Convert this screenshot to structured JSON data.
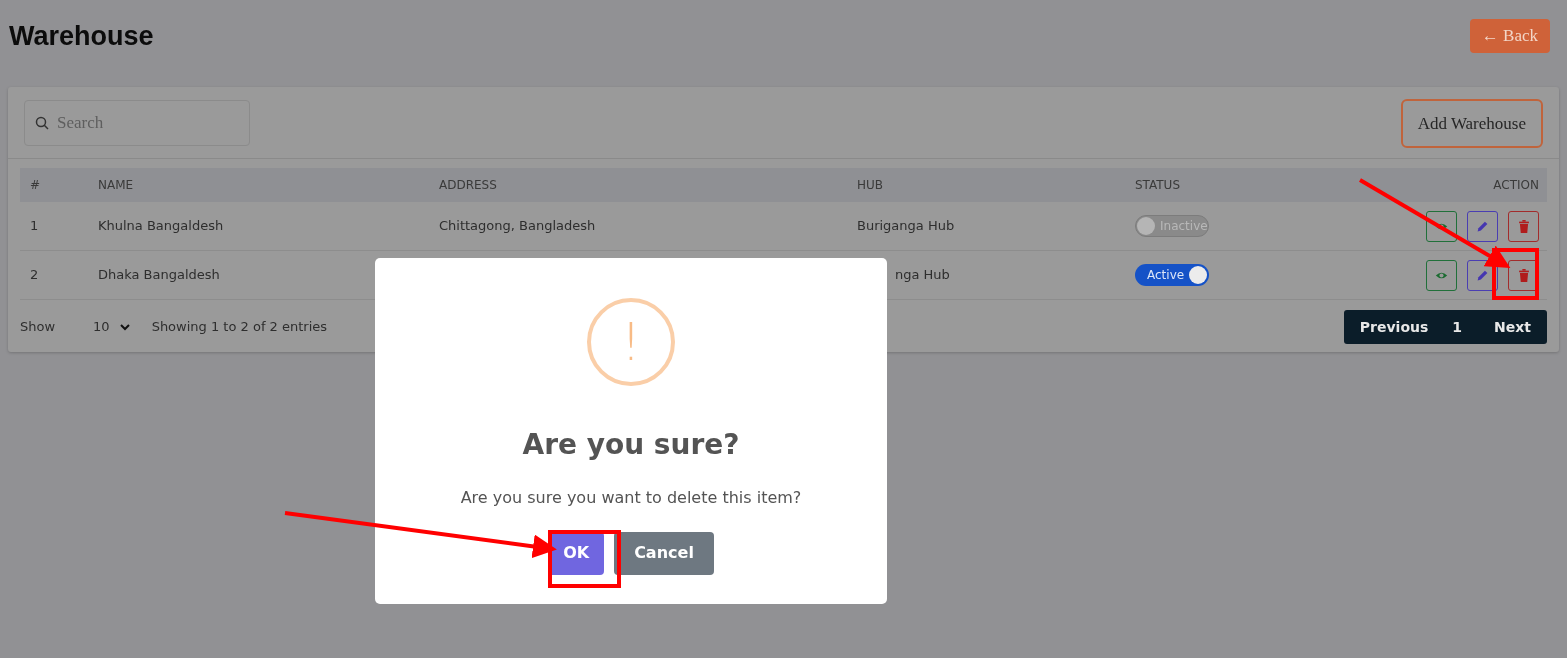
{
  "page": {
    "title": "Warehouse",
    "back_button": {
      "arrow": "←",
      "label": "Back"
    }
  },
  "toolbar": {
    "search": {
      "placeholder": "Search"
    },
    "add_button": "Add Warehouse"
  },
  "table": {
    "columns": [
      "#",
      "NAME",
      "ADDRESS",
      "HUB",
      "STATUS",
      "ACTION"
    ],
    "rows": [
      {
        "index": "1",
        "name": "Khulna Bangaldesh",
        "address": "Chittagong, Bangladesh",
        "hub": "Buriganga Hub",
        "hub_cut_left": false,
        "status": {
          "on": false,
          "label": "Inactive"
        }
      },
      {
        "index": "2",
        "name": "Dhaka Bangaldesh",
        "hub": "nga Hub",
        "hub_cut_left": true,
        "status": {
          "on": true,
          "label": "Active"
        }
      }
    ]
  },
  "footer": {
    "show_label": "Show",
    "page_size": "10",
    "entries": "Showing 1 to 2 of 2 entries",
    "pagination": [
      {
        "label": "Previous",
        "kind": "prev"
      },
      {
        "label": "1",
        "kind": "page"
      },
      {
        "label": "Next",
        "kind": "next"
      }
    ]
  },
  "dialog": {
    "icon": "!",
    "title": "Are you sure?",
    "message": "Are you sure you want to delete this item?",
    "buttons": [
      {
        "label": "OK",
        "kind": "confirm"
      },
      {
        "label": "Cancel",
        "kind": "cancel"
      }
    ]
  }
}
